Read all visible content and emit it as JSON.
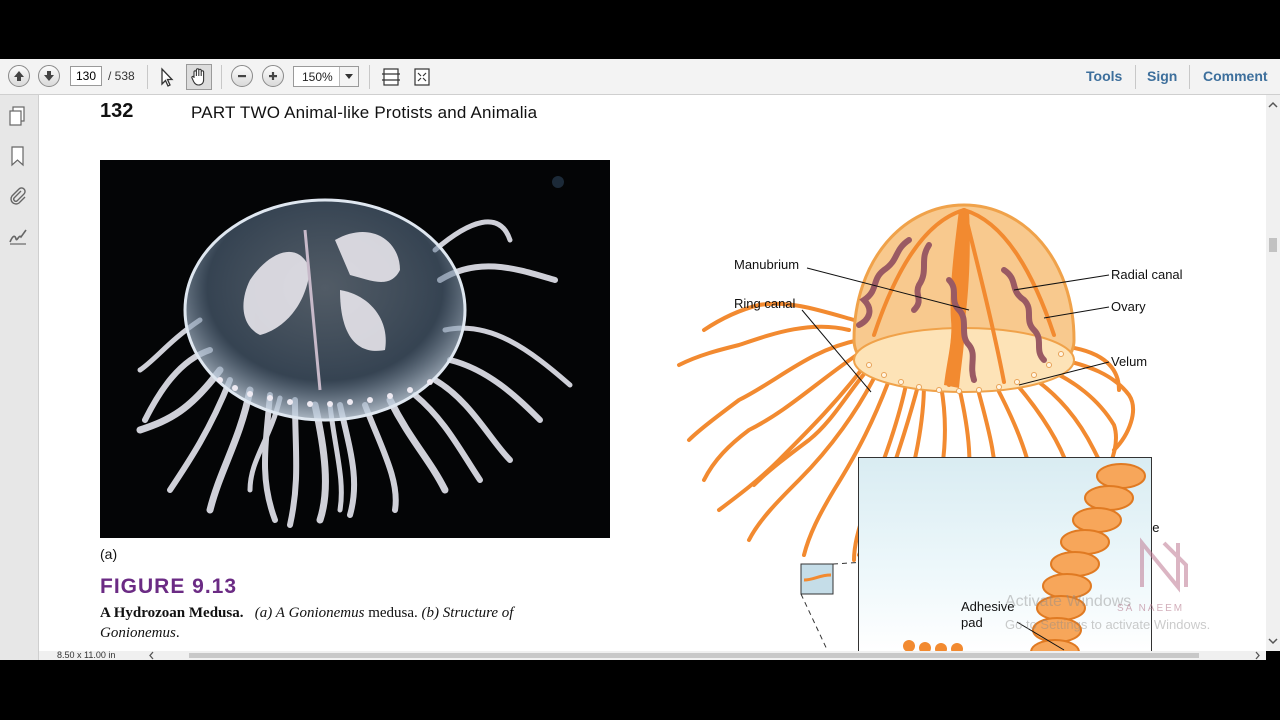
{
  "toolbar": {
    "page_current": "130",
    "page_total": "/ 538",
    "zoom": "150%",
    "tools_label": "Tools",
    "sign_label": "Sign",
    "comment_label": "Comment"
  },
  "page": {
    "number": "132",
    "header": "PART TWO   Animal-like Protists and Animalia",
    "figure_label_a": "(a)",
    "figure_number": "FIGURE 9.13",
    "caption_title": "A Hydrozoan Medusa.",
    "caption_a": "(a) A",
    "caption_genus1": "Gonionemus",
    "caption_medusa": "medusa.",
    "caption_b": "(b) Structure of",
    "caption_genus2": "Gonionemus",
    "caption_period": "."
  },
  "diagram": {
    "labels": {
      "manubrium": "Manubrium",
      "ring_canal": "Ring canal",
      "radial_canal": "Radial canal",
      "ovary": "Ovary",
      "velum": "Velum",
      "tentacle": "Tentacle",
      "adhesive_pad_1": "Adhesive",
      "adhesive_pad_2": "pad"
    }
  },
  "watermark": {
    "activate_title": "Activate Windows",
    "activate_sub": "Go to Settings to activate Windows.",
    "logo_text": "SA NAEEM"
  },
  "statusbar": {
    "page_size": "8.50 x 11.00 in"
  },
  "colors": {
    "figure_purple": "#6b2b84",
    "link_blue": "#3d6f9c",
    "jelly_orange": "#f28a30"
  },
  "icons": [
    "arrow-up-icon",
    "arrow-down-icon",
    "select-cursor-icon",
    "hand-icon",
    "zoom-out-icon",
    "zoom-in-icon",
    "fit-page-icon",
    "read-mode-icon",
    "pages-icon",
    "bookmark-icon",
    "attachment-icon",
    "sign-icon"
  ]
}
